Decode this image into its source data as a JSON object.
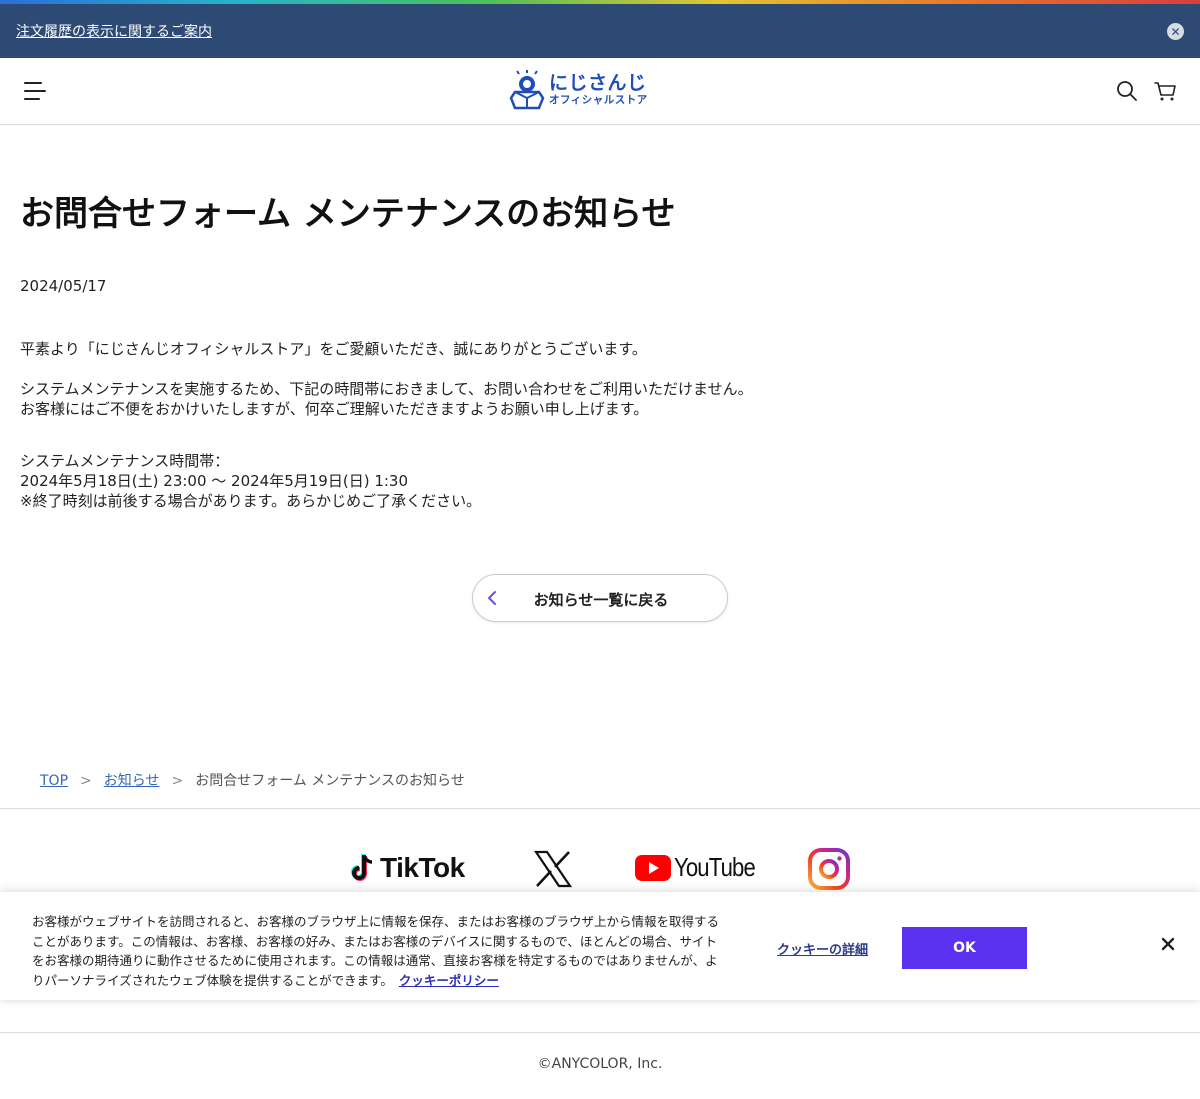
{
  "notice_bar": {
    "link_text": "注文履歴の表示に関するご案内",
    "close_label": "✕"
  },
  "header": {
    "logo_main": "にじさんじ",
    "logo_sub": "オフィシャルストア"
  },
  "article": {
    "title": "お問合せフォーム メンテナンスのお知らせ",
    "date": "2024/05/17",
    "paragraph1": "平素より「にじさんじオフィシャルストア」をご愛顧いただき、誠にありがとうございます。",
    "paragraph2_line1": "システムメンテナンスを実施するため、下記の時間帯におきまして、お問い合わせをご利用いただけません。",
    "paragraph2_line2": "お客様にはご不便をおかけいたしますが、何卒ご理解いただきますようお願い申し上げます。",
    "maintenance_label": "システムメンテナンス時間帯：",
    "maintenance_time": "2024年5月18日(土) 23:00 〜 2024年5月19日(日) 1:30",
    "maintenance_note": "※終了時刻は前後する場合があります。あらかじめご了承ください。"
  },
  "back_button": {
    "label": "お知らせ一覧に戻る"
  },
  "breadcrumb": {
    "items": [
      "TOP",
      "お知らせ",
      "お問合せフォーム メンテナンスのお知らせ"
    ],
    "separator": ">"
  },
  "social": {
    "tiktok_label": "TikTok",
    "youtube_label": "YouTube"
  },
  "cookie_banner": {
    "text": "お客様がウェブサイトを訪問されると、お客様のブラウザ上に情報を保存、またはお客様のブラウザ上から情報を取得することがあります。この情報は、お客様、お客様の好み、またはお客様のデバイスに関するもので、ほとんどの場合、サイトをお客様の期待通りに動作させるために使用されます。この情報は通常、直接お客様を特定するものではありませんが、よりパーソナライズされたウェブ体験を提供することができます。",
    "policy_link": "クッキーポリシー",
    "details_link": "クッキーの詳細",
    "ok_label": "OK"
  },
  "footer": {
    "copyright": "©ANYCOLOR, Inc."
  },
  "colors": {
    "notice_bar_bg": "#2c4a74",
    "brand_blue": "#1f4fb6",
    "ok_button": "#5a32f0",
    "link": "#3567b8"
  }
}
